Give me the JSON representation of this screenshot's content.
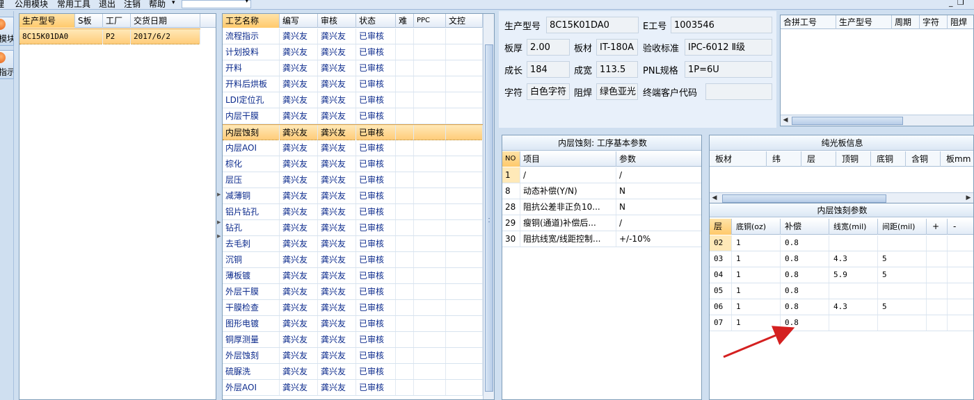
{
  "menu": {
    "items": [
      "理",
      "公用模块",
      "常用工具",
      "退出",
      "注销",
      "帮助"
    ],
    "help_arrow": "▾",
    "combo_value": "",
    "minimize_glyph": "_",
    "restore_glyph": "❐"
  },
  "launcher": {
    "buttons": [
      {
        "label": "模块",
        "icon": "orange-orb-icon"
      },
      {
        "label": "指示",
        "icon": "orange-orb-icon"
      }
    ]
  },
  "model_list": {
    "headers": [
      "生产型号",
      "S板",
      "工厂",
      "交货日期"
    ],
    "rows": [
      {
        "model": "8C15K01DA0",
        "s_board": "",
        "factory": "P2",
        "delivery": "2017/6/2"
      }
    ]
  },
  "process_list": {
    "headers": [
      "工艺名称",
      "编写",
      "审核",
      "状态",
      "难",
      "PPC",
      "文控"
    ],
    "rows": [
      {
        "name": "流程指示",
        "writer": "龚兴友",
        "reviewer": "龚兴友",
        "status": "已审核"
      },
      {
        "name": "计划投料",
        "writer": "龚兴友",
        "reviewer": "龚兴友",
        "status": "已审核"
      },
      {
        "name": "开料",
        "writer": "龚兴友",
        "reviewer": "龚兴友",
        "status": "已审核"
      },
      {
        "name": "开料后烘板",
        "writer": "龚兴友",
        "reviewer": "龚兴友",
        "status": "已审核"
      },
      {
        "name": "LDI定位孔",
        "writer": "龚兴友",
        "reviewer": "龚兴友",
        "status": "已审核"
      },
      {
        "name": "内层干膜",
        "writer": "龚兴友",
        "reviewer": "龚兴友",
        "status": "已审核"
      },
      {
        "name": "内层蚀刻",
        "writer": "龚兴友",
        "reviewer": "龚兴友",
        "status": "已审核"
      },
      {
        "name": "内层AOI",
        "writer": "龚兴友",
        "reviewer": "龚兴友",
        "status": "已审核"
      },
      {
        "name": "棕化",
        "writer": "龚兴友",
        "reviewer": "龚兴友",
        "status": "已审核"
      },
      {
        "name": "层压",
        "writer": "龚兴友",
        "reviewer": "龚兴友",
        "status": "已审核"
      },
      {
        "name": "减薄铜",
        "writer": "龚兴友",
        "reviewer": "龚兴友",
        "status": "已审核"
      },
      {
        "name": "铝片钻孔",
        "writer": "龚兴友",
        "reviewer": "龚兴友",
        "status": "已审核"
      },
      {
        "name": "钻孔",
        "writer": "龚兴友",
        "reviewer": "龚兴友",
        "status": "已审核"
      },
      {
        "name": "去毛刺",
        "writer": "龚兴友",
        "reviewer": "龚兴友",
        "status": "已审核"
      },
      {
        "name": "沉铜",
        "writer": "龚兴友",
        "reviewer": "龚兴友",
        "status": "已审核"
      },
      {
        "name": "薄板镀",
        "writer": "龚兴友",
        "reviewer": "龚兴友",
        "status": "已审核"
      },
      {
        "name": "外层干膜",
        "writer": "龚兴友",
        "reviewer": "龚兴友",
        "status": "已审核"
      },
      {
        "name": "干膜检查",
        "writer": "龚兴友",
        "reviewer": "龚兴友",
        "status": "已审核"
      },
      {
        "name": "图形电镀",
        "writer": "龚兴友",
        "reviewer": "龚兴友",
        "status": "已审核"
      },
      {
        "name": "铜厚测量",
        "writer": "龚兴友",
        "reviewer": "龚兴友",
        "status": "已审核"
      },
      {
        "name": "外层蚀刻",
        "writer": "龚兴友",
        "reviewer": "龚兴友",
        "status": "已审核"
      },
      {
        "name": "硫脲洗",
        "writer": "龚兴友",
        "reviewer": "龚兴友",
        "status": "已审核"
      },
      {
        "name": "外层AOI",
        "writer": "龚兴友",
        "reviewer": "龚兴友",
        "status": "已审核"
      }
    ],
    "selected_index": 6
  },
  "product_info": {
    "model_label": "生产型号",
    "model_value": "8C15K01DA0",
    "e_no_label": "E工号",
    "e_no_value": "1003546",
    "thickness_label": "板厚",
    "thickness_value": "2.00",
    "material_label": "板材",
    "material_value": "IT-180A",
    "standard_label": "验收标准",
    "standard_value": "IPC-6012 Ⅱ级",
    "length_label": "成长",
    "length_value": "184",
    "width_label": "成宽",
    "width_value": "113.5",
    "pnl_label": "PNL规格",
    "pnl_value": "1P=6U",
    "legend_label": "字符",
    "legend_value": "白色字符",
    "mask_label": "阻焊",
    "mask_value": "绿色亚光",
    "customer_code_label": "终端客户代码",
    "customer_code_value": ""
  },
  "combine_grid": {
    "headers": [
      "合拼工号",
      "生产型号",
      "周期",
      "字符",
      "阻焊"
    ]
  },
  "basic_params": {
    "title": "内层蚀刻: 工序基本参数",
    "headers": [
      "NO",
      "项目",
      "参数"
    ],
    "rows": [
      {
        "no": "1",
        "item": "/",
        "value": "/"
      },
      {
        "no": "8",
        "item": "动态补偿(Y/N)",
        "value": "N"
      },
      {
        "no": "28",
        "item": "阻抗公差非正负10...",
        "value": "N"
      },
      {
        "no": "29",
        "item": "瘦铜(通道)补偿后...",
        "value": "/"
      },
      {
        "no": "30",
        "item": "阻抗线宽/线距控制...",
        "value": "+/-10%"
      }
    ]
  },
  "bare_board": {
    "title": "纯光板信息",
    "headers": [
      "板材",
      "纬",
      "层",
      "顶铜",
      "底铜",
      "含铜",
      "板mm"
    ]
  },
  "etch_params": {
    "title": "内层蚀刻参数",
    "headers": [
      "层",
      "底铜(oz)",
      "补偿",
      "线宽(mil)",
      "间距(mil)",
      "+",
      "-"
    ],
    "rows": [
      {
        "layer": "02",
        "base_cu": "1",
        "comp": "0.8",
        "width": "",
        "space": ""
      },
      {
        "layer": "03",
        "base_cu": "1",
        "comp": "0.8",
        "width": "4.3",
        "space": "5"
      },
      {
        "layer": "04",
        "base_cu": "1",
        "comp": "0.8",
        "width": "5.9",
        "space": "5"
      },
      {
        "layer": "05",
        "base_cu": "1",
        "comp": "0.8",
        "width": "",
        "space": ""
      },
      {
        "layer": "06",
        "base_cu": "1",
        "comp": "0.8",
        "width": "4.3",
        "space": "5"
      },
      {
        "layer": "07",
        "base_cu": "1",
        "comp": "0.8",
        "width": "",
        "space": ""
      }
    ]
  },
  "annotation": {
    "color": "#d42020"
  },
  "colors": {
    "selection": "#ffcc7a",
    "header_blue": "#0b2a8c",
    "panel_bg": "#cfdff0"
  }
}
